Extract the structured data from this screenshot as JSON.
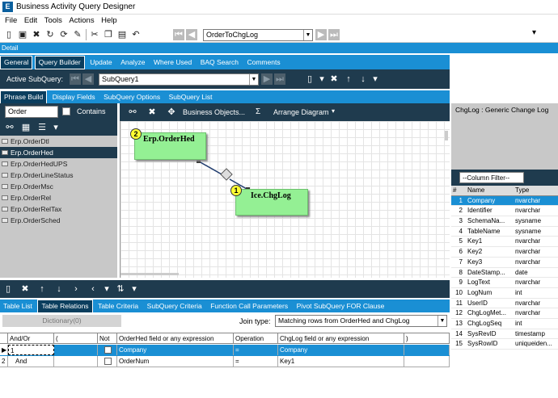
{
  "window": {
    "title": "Business Activity Query Designer",
    "logo": "E"
  },
  "menu": [
    "File",
    "Edit",
    "Tools",
    "Actions",
    "Help"
  ],
  "toolbar": {
    "query_selector": "OrderToChgLog"
  },
  "detail_label": "Detail",
  "main_tabs": [
    "General",
    "Query Builder",
    "Update",
    "Analyze",
    "Where Used",
    "BAQ Search",
    "Comments"
  ],
  "subquery": {
    "label": "Active SubQuery:",
    "value": "SubQuery1"
  },
  "sub_tabs": [
    "Phrase Build",
    "Display Fields",
    "SubQuery Options",
    "SubQuery List"
  ],
  "search": {
    "value": "Order",
    "contains_label": "Contains"
  },
  "tables": [
    "Erp.OrderDtl",
    "Erp.OrderHed",
    "Erp.OrderHedUPS",
    "Erp.OrderLineStatus",
    "Erp.OrderMsc",
    "Erp.OrderRel",
    "Erp.OrderRelTax",
    "Erp.OrderSched"
  ],
  "diagram_toolbar": {
    "business_objects": "Business Objects...",
    "sigma": "Σ",
    "arrange": "Arrange Diagram"
  },
  "diagram_nodes": [
    {
      "num": "2",
      "name": "Erp.OrderHed"
    },
    {
      "num": "1",
      "name": "Ice.ChgLog"
    }
  ],
  "right_panel": {
    "header": "ChgLog : Generic Change Log",
    "filter": "--Column Filter--",
    "col_hash": "#",
    "col_name": "Name",
    "col_type": "Type",
    "columns": [
      [
        "1",
        "Company",
        "nvarchar"
      ],
      [
        "2",
        "Identifier",
        "nvarchar"
      ],
      [
        "3",
        "SchemaNa...",
        "sysname"
      ],
      [
        "4",
        "TableName",
        "sysname"
      ],
      [
        "5",
        "Key1",
        "nvarchar"
      ],
      [
        "6",
        "Key2",
        "nvarchar"
      ],
      [
        "7",
        "Key3",
        "nvarchar"
      ],
      [
        "8",
        "DateStamp...",
        "date"
      ],
      [
        "9",
        "LogText",
        "nvarchar"
      ],
      [
        "10",
        "LogNum",
        "int"
      ],
      [
        "11",
        "UserID",
        "nvarchar"
      ],
      [
        "12",
        "ChgLogMet...",
        "nvarchar"
      ],
      [
        "13",
        "ChgLogSeq",
        "int"
      ],
      [
        "14",
        "SysRevID",
        "timestamp"
      ],
      [
        "15",
        "SysRowID",
        "uniqueiden..."
      ]
    ]
  },
  "bottom_tabs": [
    "Table List",
    "Table Relations",
    "Table Criteria",
    "SubQuery Criteria",
    "Function Call Parameters",
    "Pivot SubQuery FOR Clause"
  ],
  "relations": {
    "dictionary": "Dictionary(0)",
    "join_label": "Join type:",
    "join_value": "Matching rows from OrderHed and ChgLog",
    "headers": [
      "And/Or",
      "(",
      "Not",
      "OrderHed field or any expression",
      "Operation",
      "ChgLog field or any expression",
      ")"
    ],
    "rows": [
      {
        "num": "1",
        "andor": "",
        "left": "Company",
        "op": "=",
        "right": "Company"
      },
      {
        "num": "2",
        "andor": "And",
        "left": "OrderNum",
        "op": "=",
        "right": "Key1"
      }
    ]
  }
}
